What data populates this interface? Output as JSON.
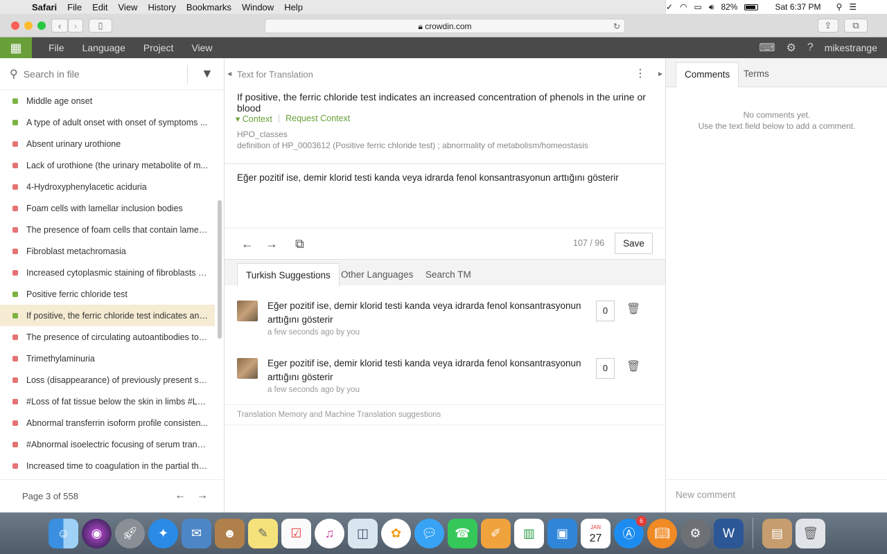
{
  "menubar": {
    "app": "Safari",
    "items": [
      "File",
      "Edit",
      "View",
      "History",
      "Bookmarks",
      "Window",
      "Help"
    ],
    "battery": "82%",
    "clock": "Sat 6:37 PM"
  },
  "browser": {
    "url": "crowdin.com"
  },
  "toolbar": {
    "menus": [
      "File",
      "Language",
      "Project",
      "View"
    ],
    "username": "mikestrange"
  },
  "sidebar": {
    "search_placeholder": "Search in file",
    "strings": [
      {
        "text": "Middle age onset",
        "status": "translated"
      },
      {
        "text": "A type of adult onset with onset of symptoms ...",
        "status": "translated"
      },
      {
        "text": "Absent urinary urothione",
        "status": "untranslated"
      },
      {
        "text": "Lack of urothione (the urinary metabolite of m...",
        "status": "untranslated"
      },
      {
        "text": "4-Hydroxyphenylacetic aciduria",
        "status": "untranslated"
      },
      {
        "text": "Foam cells with lamellar inclusion bodies",
        "status": "untranslated"
      },
      {
        "text": "The presence of foam cells that contain lamell...",
        "status": "untranslated"
      },
      {
        "text": "Fibroblast metachromasia",
        "status": "untranslated"
      },
      {
        "text": "Increased cytoplasmic staining of fibroblasts w...",
        "status": "untranslated"
      },
      {
        "text": "Positive ferric chloride test",
        "status": "translated"
      },
      {
        "text": "If positive, the ferric chloride test indicates an i...",
        "status": "translated",
        "active": true
      },
      {
        "text": "The presence of circulating autoantibodies to ...",
        "status": "untranslated"
      },
      {
        "text": "Trimethylaminuria",
        "status": "untranslated"
      },
      {
        "text": "Loss (disappearance) of previously present su...",
        "status": "untranslated"
      },
      {
        "text": "#Loss of fat tissue below the skin in limbs #Lo...",
        "status": "untranslated"
      },
      {
        "text": "Abnormal transferrin isoform profile consisten...",
        "status": "untranslated"
      },
      {
        "text": "#Abnormal isoelectric focusing of serum trans...",
        "status": "untranslated"
      },
      {
        "text": "Increased time to coagulation in the partial thr...",
        "status": "untranslated"
      }
    ],
    "pager": "Page 3 of 558"
  },
  "editor": {
    "header": "Text for Translation",
    "source": "If positive, the ferric chloride test indicates an increased concentration of phenols in the urine or blood",
    "context_label": "Context",
    "request_context_label": "Request Context",
    "context_file": "HPO_classes",
    "context_desc": "definition of HP_0003612 (Positive ferric chloride test) ; abnormality of metabolism/homeostasis",
    "translation": "Eğer pozitif ise, demir klorid testi kanda veya idrarda fenol konsantrasyonun arttığını gösterir",
    "counter": "107 / 96",
    "save_label": "Save"
  },
  "suggestion_tabs": [
    "Turkish Suggestions",
    "Other Languages",
    "Search TM"
  ],
  "suggestions": [
    {
      "text": "Eğer pozitif ise, demir klorid testi kanda veya idrarda fenol konsantrasyonun arttığını gösterir",
      "meta": "a few seconds ago by you",
      "votes": "0"
    },
    {
      "text": "Eger pozitif ise, demir klorid testi kanda veya idrarda fenol konsantrasyonun arttığını gösterir",
      "meta": "a few seconds ago by you",
      "votes": "0"
    }
  ],
  "tm_note": "Translation Memory and Machine Translation suggestions",
  "comments": {
    "tabs": [
      "Comments",
      "Terms"
    ],
    "empty_line1": "No comments yet.",
    "empty_line2": "Use the text field below to add a comment.",
    "new_placeholder": "New comment"
  },
  "dock": {
    "calendar_day": "27",
    "calendar_month": "JAN",
    "appstore_badge": "6"
  },
  "colors": {
    "brand_green": "#689f38",
    "translated": "#7cb342",
    "untranslated": "#e57373"
  }
}
